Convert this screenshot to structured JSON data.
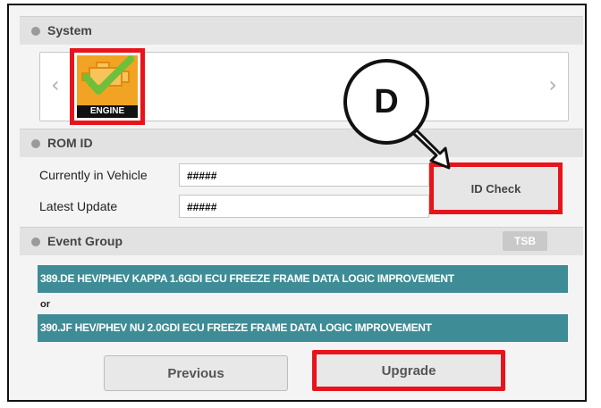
{
  "system": {
    "title": "System",
    "engine_label": "ENGINE",
    "left_arrow": "‹",
    "right_arrow": "›"
  },
  "rom_id": {
    "title": "ROM ID",
    "currently_label": "Currently in Vehicle",
    "currently_value": "#####",
    "latest_label": "Latest Update",
    "latest_value": "#####",
    "id_check_label": "ID Check"
  },
  "event_group": {
    "title": "Event Group",
    "tsb_label": "TSB",
    "items": [
      "389.DE HEV/PHEV KAPPA 1.6GDI ECU FREEZE FRAME DATA LOGIC IMPROVEMENT",
      "390.JF HEV/PHEV NU 2.0GDI ECU FREEZE FRAME DATA LOGIC IMPROVEMENT"
    ],
    "or_text": "or"
  },
  "buttons": {
    "previous": "Previous",
    "upgrade": "Upgrade"
  },
  "callout": {
    "letter": "D"
  },
  "colors": {
    "highlight": "#e8141b",
    "event_bar": "#3d8c96",
    "engine_tile": "#f2a323",
    "check": "#6fbf3a"
  }
}
